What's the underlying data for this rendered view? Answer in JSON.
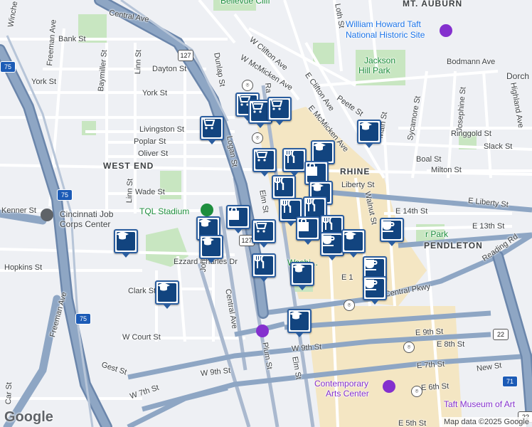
{
  "map": {
    "colors": {
      "land": "#eef0f4",
      "park": "#c8e6c1",
      "highway": "#8ea6c4",
      "highway_edge": "#6b86ab",
      "road": "#ffffff",
      "district": "#f4e6c3",
      "building": "#e3e6ea"
    },
    "neighborhoods": [
      {
        "id": "mt-auburn",
        "text": "MT. AUBURN"
      },
      {
        "id": "west-end",
        "text": "WEST END"
      },
      {
        "id": "otr",
        "text": "RHINE"
      },
      {
        "id": "pendleton",
        "text": "PENDLETON"
      }
    ],
    "places": [
      {
        "id": "bellevue",
        "text": "Bellevue Cliff"
      },
      {
        "id": "taft-site-1",
        "text": "William Howard Taft"
      },
      {
        "id": "taft-site-2",
        "text": "National Historic Site"
      },
      {
        "id": "jackson-1",
        "text": "Jackson"
      },
      {
        "id": "jackson-2",
        "text": "Hill Park"
      },
      {
        "id": "tql",
        "text": "TQL Stadium"
      },
      {
        "id": "job-1",
        "text": "Cincinnati Job"
      },
      {
        "id": "job-2",
        "text": "Corps Center"
      },
      {
        "id": "wash",
        "text": "Washi..."
      },
      {
        "id": "contemp-1",
        "text": "Contemporary"
      },
      {
        "id": "contemp-2",
        "text": "Arts Center"
      },
      {
        "id": "taft-museum",
        "text": "Taft Museum of Art"
      },
      {
        "id": "park",
        "text": "r Park"
      },
      {
        "id": "dorch",
        "text": "Dorch"
      }
    ],
    "streets": [
      {
        "id": "winche",
        "text": "Winche"
      },
      {
        "id": "central-ave-top",
        "text": "Central Ave"
      },
      {
        "id": "bank",
        "text": "Bank St"
      },
      {
        "id": "freeman-top",
        "text": "Freeman Ave"
      },
      {
        "id": "baymiller",
        "text": "Baymiller St"
      },
      {
        "id": "linn-top",
        "text": "Linn St"
      },
      {
        "id": "dayton",
        "text": "Dayton St"
      },
      {
        "id": "york",
        "text": "York St"
      },
      {
        "id": "york2",
        "text": "York St"
      },
      {
        "id": "dunlap",
        "text": "Dunlap St"
      },
      {
        "id": "wclifton",
        "text": "W Clifton Ave"
      },
      {
        "id": "wmcmicken",
        "text": "W McMicken Ave"
      },
      {
        "id": "ra",
        "text": "Ra"
      },
      {
        "id": "eclifton",
        "text": "E Clifton Ave"
      },
      {
        "id": "emcmicken",
        "text": "E McMicken Ave"
      },
      {
        "id": "loth",
        "text": "Loth St"
      },
      {
        "id": "peete",
        "text": "Peete St"
      },
      {
        "id": "bodmann",
        "text": "Bodmann Ave"
      },
      {
        "id": "sycamore",
        "text": "Sycamore St"
      },
      {
        "id": "josephine",
        "text": "Josephine St"
      },
      {
        "id": "highland",
        "text": "Highland Ave"
      },
      {
        "id": "ringgold",
        "text": "Ringgold St"
      },
      {
        "id": "slack",
        "text": "Slack St"
      },
      {
        "id": "boal",
        "text": "Boal St"
      },
      {
        "id": "milton",
        "text": "Milton St"
      },
      {
        "id": "main",
        "text": "Main St"
      },
      {
        "id": "livingston",
        "text": "Livingston St"
      },
      {
        "id": "poplar",
        "text": "Poplar St"
      },
      {
        "id": "oliver",
        "text": "Oliver St"
      },
      {
        "id": "logan",
        "text": "Logan St"
      },
      {
        "id": "wade",
        "text": "Wade St"
      },
      {
        "id": "linn-mid",
        "text": "Linn St"
      },
      {
        "id": "elm-mid",
        "text": "Elm St"
      },
      {
        "id": "walnut",
        "text": "Walnut St"
      },
      {
        "id": "liberty",
        "text": "Liberty St"
      },
      {
        "id": "eliberty",
        "text": "E Liberty St"
      },
      {
        "id": "e14",
        "text": "E 14th St"
      },
      {
        "id": "e13",
        "text": "E 13th St"
      },
      {
        "id": "kenner",
        "text": "Kenner St"
      },
      {
        "id": "hopkins",
        "text": "Hopkins St"
      },
      {
        "id": "ezzard",
        "text": "Ezzard Charles Dr"
      },
      {
        "id": "john",
        "text": "John St"
      },
      {
        "id": "central-ave-mid",
        "text": "Central Ave"
      },
      {
        "id": "reading",
        "text": "Reading Rd"
      },
      {
        "id": "clark",
        "text": "Clark St"
      },
      {
        "id": "central-pkwy",
        "text": "Central Pkwy"
      },
      {
        "id": "e1",
        "text": "E 1"
      },
      {
        "id": "wcourt",
        "text": "W Court St"
      },
      {
        "id": "freeman-bot",
        "text": "Freeman Ave"
      },
      {
        "id": "plum",
        "text": "Plum St"
      },
      {
        "id": "elm-bot",
        "text": "Elm St"
      },
      {
        "id": "w9th",
        "text": "W 9th St"
      },
      {
        "id": "e9th",
        "text": "E 9th St"
      },
      {
        "id": "w9th2",
        "text": "W 9th St"
      },
      {
        "id": "e8th",
        "text": "E 8th St"
      },
      {
        "id": "gest",
        "text": "Gest St"
      },
      {
        "id": "e7th",
        "text": "E 7th St"
      },
      {
        "id": "newst",
        "text": "New St"
      },
      {
        "id": "w7th",
        "text": "W 7th St"
      },
      {
        "id": "e6th",
        "text": "E 6th St"
      },
      {
        "id": "carst",
        "text": "Car St"
      },
      {
        "id": "e5th",
        "text": "E 5th St"
      }
    ],
    "shields": [
      {
        "id": "i75a",
        "text": "75",
        "kind": "interstate"
      },
      {
        "id": "i75b",
        "text": "75",
        "kind": "interstate"
      },
      {
        "id": "i75c",
        "text": "75",
        "kind": "interstate"
      },
      {
        "id": "i71",
        "text": "71",
        "kind": "interstate"
      },
      {
        "id": "us127a",
        "text": "127",
        "kind": "us"
      },
      {
        "id": "us127b",
        "text": "127",
        "kind": "us"
      },
      {
        "id": "us22a",
        "text": "22",
        "kind": "us"
      },
      {
        "id": "us22b",
        "text": "22",
        "kind": "us"
      }
    ],
    "logo": "Google",
    "attribution": "Map data ©2025 Google"
  },
  "markers": [
    {
      "id": "m1",
      "icon": "grocery-cart-icon"
    },
    {
      "id": "m2",
      "icon": "grocery-cart-icon"
    },
    {
      "id": "m3",
      "icon": "grocery-cart-icon"
    },
    {
      "id": "m4",
      "icon": "grocery-cart-icon"
    },
    {
      "id": "m5",
      "icon": "grocery-cart-icon"
    },
    {
      "id": "m6",
      "icon": "graduation-cap-icon"
    },
    {
      "id": "m7",
      "icon": "graduation-cap-icon"
    },
    {
      "id": "m8",
      "icon": "restaurant-icon"
    },
    {
      "id": "m9",
      "icon": "shopping-bag-icon"
    },
    {
      "id": "m10",
      "icon": "graduation-cap-icon"
    },
    {
      "id": "m11",
      "icon": "restaurant-icon"
    },
    {
      "id": "m12",
      "icon": "shopping-bag-icon"
    },
    {
      "id": "m13",
      "icon": "grocery-cart-icon"
    },
    {
      "id": "m14",
      "icon": "restaurant-icon"
    },
    {
      "id": "m15",
      "icon": "restaurant-icon"
    },
    {
      "id": "m16",
      "icon": "shopping-bag-icon"
    },
    {
      "id": "m17",
      "icon": "restaurant-icon"
    },
    {
      "id": "m18",
      "icon": "graduation-cap-icon"
    },
    {
      "id": "m19",
      "icon": "graduation-cap-icon"
    },
    {
      "id": "m20",
      "icon": "coffee-cup-icon"
    },
    {
      "id": "m21",
      "icon": "coffee-cup-icon"
    },
    {
      "id": "m22",
      "icon": "coffee-cup-icon"
    },
    {
      "id": "m23",
      "icon": "coffee-cup-icon"
    },
    {
      "id": "m24",
      "icon": "graduation-cap-icon"
    },
    {
      "id": "m25",
      "icon": "graduation-cap-icon"
    },
    {
      "id": "m26",
      "icon": "graduation-cap-icon"
    },
    {
      "id": "m27",
      "icon": "graduation-cap-icon"
    },
    {
      "id": "m28",
      "icon": "restaurant-icon"
    },
    {
      "id": "m29",
      "icon": "graduation-cap-icon"
    }
  ]
}
